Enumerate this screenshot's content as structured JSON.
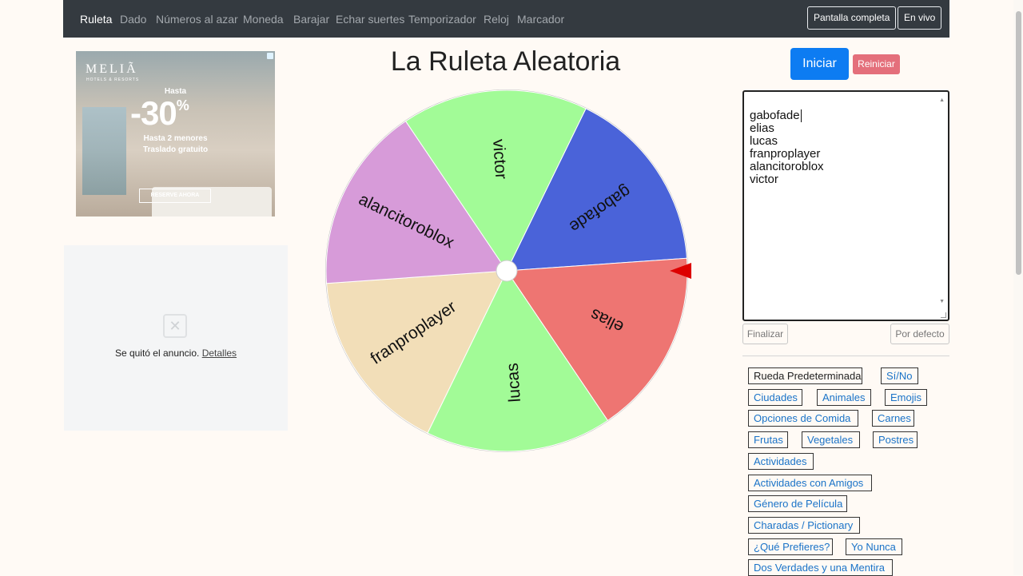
{
  "nav": {
    "links": [
      "Ruleta",
      "Dado",
      "Números al azar",
      "Moneda",
      "Barajar",
      "Echar suertes",
      "Temporizador",
      "Reloj",
      "Marcador"
    ],
    "active": "Ruleta",
    "fullscreen_label": "Pantalla completa",
    "live_label": "En vivo"
  },
  "ad_melia": {
    "logo": "MELIÃ",
    "logo_sub": "HOTELS & RESORTS",
    "hasta": "Hasta",
    "discount": "-30",
    "percent": "%",
    "line1": "Hasta 2 menores",
    "line2": "Traslado gratuito",
    "cta": "RESERVE AHORA"
  },
  "ad_removed": {
    "text": "Se quitó el anuncio.",
    "link": "Detalles"
  },
  "title": "La Ruleta Aleatoria",
  "controls": {
    "start_label": "Iniciar",
    "reset_label": "Reiniciar",
    "finish_label": "Finalizar",
    "default_label": "Por defecto"
  },
  "names": [
    "gabofade",
    "elias",
    "lucas",
    "franproplayer",
    "alancitoroblox",
    "victor"
  ],
  "wheel": {
    "segments": [
      {
        "label": "gabofade",
        "color": "#4a63d9"
      },
      {
        "label": "elias",
        "color": "#ee7572"
      },
      {
        "label": "lucas",
        "color": "#a2fb97"
      },
      {
        "label": "franproplayer",
        "color": "#f2deb8"
      },
      {
        "label": "alancitoroblox",
        "color": "#d79bd9"
      },
      {
        "label": "victor",
        "color": "#a2fb97"
      }
    ],
    "pointer_color": "#dd0000"
  },
  "presets": [
    "Rueda Predeterminada",
    "Sí/No",
    "Ciudades",
    "Animales",
    "Emojis",
    "Opciones de Comida",
    "Carnes",
    "Frutas",
    "Vegetales",
    "Postres",
    "Actividades",
    "Actividades con Amigos",
    "Género de Película",
    "Charadas / Pictionary",
    "¿Qué Prefieres?",
    "Yo Nunca",
    "Dos Verdades y una Mentira"
  ],
  "colors": {
    "nav_bg": "#343a40",
    "page_bg": "#fffaf5",
    "primary": "#0d7cf2",
    "danger": "#e46f7b",
    "link": "#1a73c8"
  }
}
